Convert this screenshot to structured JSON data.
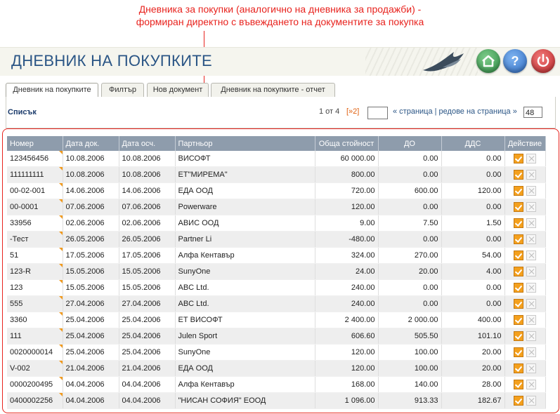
{
  "annotation": {
    "line1": "Дневника за покупки (аналогично на дневника за продажби) -",
    "line2": "формиран директно с въвеждането на документите за покупка"
  },
  "header": {
    "title": "ДНЕВНИК НА ПОКУПКИТЕ",
    "help_label": "?"
  },
  "tabs": [
    {
      "label": "Дневник на покупките",
      "active": true
    },
    {
      "label": "Филтър"
    },
    {
      "label": "Нов документ"
    },
    {
      "label": "Дневник на покупките - отчет"
    }
  ],
  "list": {
    "label": "Списък",
    "pager": {
      "count": "1 от 4",
      "next": "[»2]",
      "page_text": "« страница | редове на страница »",
      "rows_per_page": "48"
    }
  },
  "table": {
    "columns": [
      "Номер",
      "Дата док.",
      "Дата осч.",
      "Партньор",
      "Обща стойност",
      "ДО",
      "ДДС",
      "Действие"
    ],
    "rows": [
      [
        "123456456",
        "10.08.2006",
        "10.08.2006",
        "ВИСОФТ",
        "60 000.00",
        "0.00",
        "0.00"
      ],
      [
        "111111111",
        "10.08.2006",
        "10.08.2006",
        "ЕТ\"МИРЕМА\"",
        "800.00",
        "0.00",
        "0.00"
      ],
      [
        "00-02-001",
        "14.06.2006",
        "14.06.2006",
        "ЕДА ООД",
        "720.00",
        "600.00",
        "120.00"
      ],
      [
        "00-0001",
        "07.06.2006",
        "07.06.2006",
        "Powerware",
        "120.00",
        "0.00",
        "0.00"
      ],
      [
        "33956",
        "02.06.2006",
        "02.06.2006",
        "АВИС ООД",
        "9.00",
        "7.50",
        "1.50"
      ],
      [
        "-Тест",
        "26.05.2006",
        "26.05.2006",
        "Partner Li",
        "-480.00",
        "0.00",
        "0.00"
      ],
      [
        "51",
        "17.05.2006",
        "17.05.2006",
        "Алфа Кентавър",
        "324.00",
        "270.00",
        "54.00"
      ],
      [
        "123-R",
        "15.05.2006",
        "15.05.2006",
        "SunyOne",
        "24.00",
        "20.00",
        "4.00"
      ],
      [
        "123",
        "15.05.2006",
        "15.05.2006",
        "ABC Ltd.",
        "240.00",
        "0.00",
        "0.00"
      ],
      [
        "555",
        "27.04.2006",
        "27.04.2006",
        "ABC Ltd.",
        "240.00",
        "0.00",
        "0.00"
      ],
      [
        "3360",
        "25.04.2006",
        "25.04.2006",
        "ЕТ ВИСОФТ",
        "2 400.00",
        "2 000.00",
        "400.00"
      ],
      [
        "111",
        "25.04.2006",
        "25.04.2006",
        "Julen Sport",
        "606.60",
        "505.50",
        "101.10"
      ],
      [
        "0020000014",
        "25.04.2006",
        "25.04.2006",
        "SunyOne",
        "120.00",
        "100.00",
        "20.00"
      ],
      [
        "V-002",
        "21.04.2006",
        "21.04.2006",
        "ЕДА ООД",
        "120.00",
        "100.00",
        "20.00"
      ],
      [
        "0000200495",
        "04.04.2006",
        "04.04.2006",
        "Алфа Кентавър",
        "168.00",
        "140.00",
        "28.00"
      ],
      [
        "0400002256",
        "04.04.2006",
        "04.04.2006",
        "\"НИСАН СОФИЯ\" ЕООД",
        "1 096.00",
        "913.33",
        "182.67"
      ]
    ]
  },
  "colors": {
    "accent": "#2a5585",
    "annotation": "#e8231e",
    "header_bg": "#8e9cac",
    "edit": "#f4a01d"
  },
  "icons": {
    "home": "home-icon",
    "help": "help-icon",
    "power": "power-icon",
    "edit": "edit-icon",
    "delete": "delete-icon"
  }
}
